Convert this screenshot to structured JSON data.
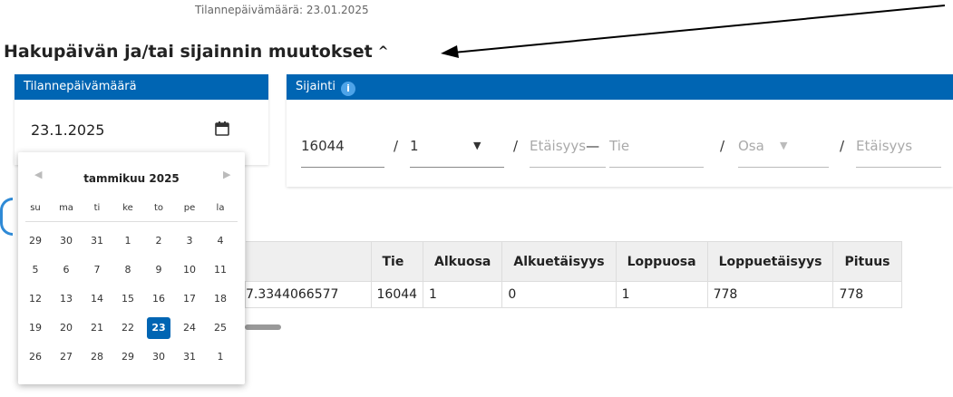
{
  "top_note": "Tilannepäivämäärä: 23.01.2025",
  "heading": "Hakupäivän ja/tai sijainnin muutokset",
  "date_card": {
    "title": "Tilannepäivämäärä",
    "value": "23.1.2025"
  },
  "location_card": {
    "title": "Sijainti",
    "fields": {
      "road": "16044",
      "part": "1",
      "distance_ph": "Etäisyys",
      "dash": "—",
      "road2_ph": "Tie",
      "part2_ph": "Osa",
      "distance2_ph": "Etäisyys"
    }
  },
  "table": {
    "headers": [
      "Tie",
      "Alkuosa",
      "Alkuetäisyys",
      "Loppuosa",
      "Loppuetäisyys",
      "Pituus"
    ],
    "row": [
      "7.3344066577",
      "16044",
      "1",
      "0",
      "1",
      "778",
      "778"
    ]
  },
  "calendar": {
    "month": "tammikuu 2025",
    "weekdays": [
      "su",
      "ma",
      "ti",
      "ke",
      "to",
      "pe",
      "la"
    ],
    "weeks": [
      [
        "29",
        "30",
        "31",
        "1",
        "2",
        "3",
        "4"
      ],
      [
        "5",
        "6",
        "7",
        "8",
        "9",
        "10",
        "11"
      ],
      [
        "12",
        "13",
        "14",
        "15",
        "16",
        "17",
        "18"
      ],
      [
        "19",
        "20",
        "21",
        "22",
        "23",
        "24",
        "25"
      ],
      [
        "26",
        "27",
        "28",
        "29",
        "30",
        "31",
        "1"
      ]
    ],
    "selected": "23"
  },
  "colors": {
    "accent": "#0065b3",
    "info": "#4da3e8"
  }
}
